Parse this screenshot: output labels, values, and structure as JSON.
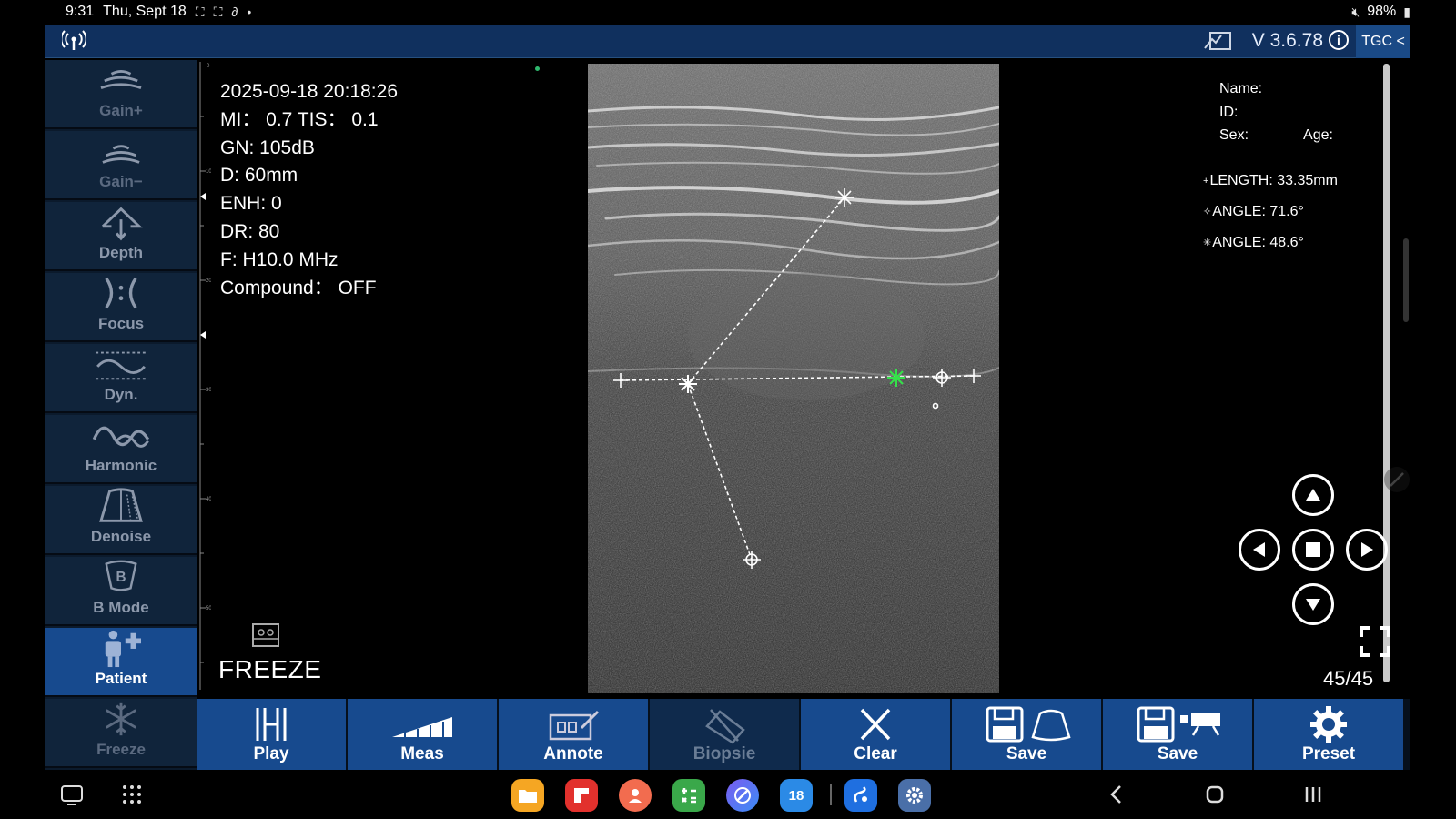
{
  "statusbar": {
    "time": "9:31",
    "date": "Thu, Sept 18",
    "battery": "98%"
  },
  "header": {
    "version": "V 3.6.78",
    "tgc_label": "TGC <"
  },
  "sidebar": {
    "items": [
      {
        "label": "Gain+"
      },
      {
        "label": "Gain−"
      },
      {
        "label": "Depth"
      },
      {
        "label": "Focus"
      },
      {
        "label": "Dyn."
      },
      {
        "label": "Harmonic"
      },
      {
        "label": "Denoise"
      },
      {
        "label": "B Mode"
      },
      {
        "label": "Patient"
      },
      {
        "label": "Freeze"
      }
    ]
  },
  "params": {
    "datetime": "2025-09-18 20:18:26",
    "mi_tis": "MI： 0.7  TIS： 0.1",
    "gain": "GN: 105dB",
    "depth": "D: 60mm",
    "enh": "ENH: 0",
    "dr": "DR: 80",
    "freq": "F: H10.0 MHz",
    "compound": "Compound： OFF"
  },
  "ruler": {
    "labels": [
      "0",
      "10",
      "20",
      "30",
      "40",
      "50"
    ]
  },
  "patient": {
    "name_label": "Name:",
    "id_label": "ID:",
    "sex_label": "Sex:",
    "age_label": "Age:"
  },
  "measurements": [
    {
      "symbol": "+",
      "text": "LENGTH: 33.35mm"
    },
    {
      "symbol": "✧",
      "text": "ANGLE: 71.6°"
    },
    {
      "symbol": "✳",
      "text": "ANGLE: 48.6°"
    }
  ],
  "freeze_indicator": "FREEZE",
  "frame_count": "45/45",
  "toolbar": {
    "items": [
      {
        "label": "Play"
      },
      {
        "label": "Meas"
      },
      {
        "label": "Annote"
      },
      {
        "label": "Biopsie"
      },
      {
        "label": "Clear"
      },
      {
        "label": "Save"
      },
      {
        "label": "Save"
      },
      {
        "label": "Preset"
      }
    ]
  },
  "calendar_app_day": "18",
  "colors": {
    "header_bg": "#10305e",
    "button_bg": "#174a8e",
    "sidebar_bg": "#10243b",
    "measure_green": "#35e04a"
  }
}
